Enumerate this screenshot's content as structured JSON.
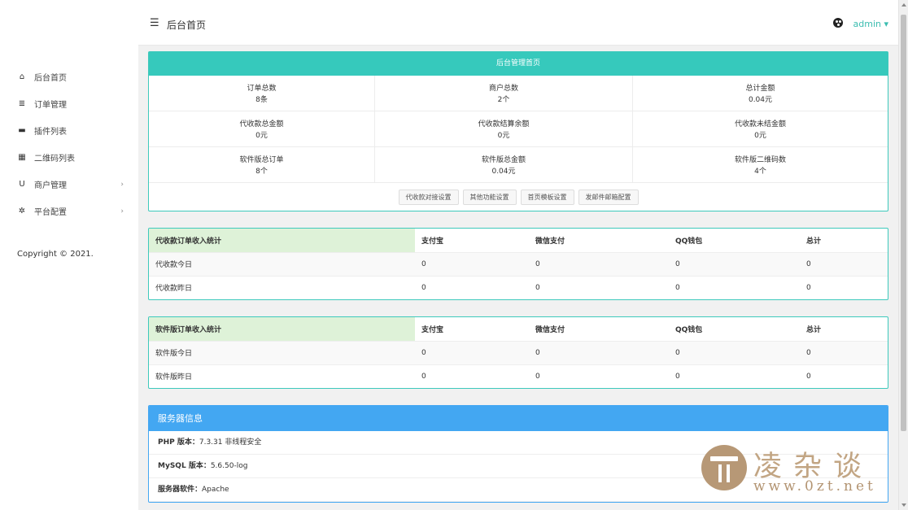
{
  "header": {
    "title": "后台首页",
    "user": "admin ▾"
  },
  "sidebar": {
    "items": [
      {
        "label": "后台首页",
        "icon": "home-icon",
        "glyph": "⌂",
        "caret": ""
      },
      {
        "label": "订单管理",
        "icon": "list-icon",
        "glyph": "≣",
        "caret": ""
      },
      {
        "label": "插件列表",
        "icon": "plugin-icon",
        "glyph": "▬",
        "caret": ""
      },
      {
        "label": "二维码列表",
        "icon": "qrcode-icon",
        "glyph": "▦",
        "caret": ""
      },
      {
        "label": "商户管理",
        "icon": "magnet-icon",
        "glyph": "U",
        "caret": "›"
      },
      {
        "label": "平台配置",
        "icon": "gear-icon",
        "glyph": "✲",
        "caret": "›"
      }
    ],
    "copyright": "Copyright © 2021."
  },
  "admin": {
    "title": "后台管理首页",
    "stats": [
      {
        "label": "订单总数",
        "value": "8条"
      },
      {
        "label": "商户总数",
        "value": "2个"
      },
      {
        "label": "总计金额",
        "value": "0.04元"
      },
      {
        "label": "代收款总金额",
        "value": "0元"
      },
      {
        "label": "代收款结算余额",
        "value": "0元"
      },
      {
        "label": "代收款未结金额",
        "value": "0元"
      },
      {
        "label": "软件版总订单",
        "value": "8个"
      },
      {
        "label": "软件版总金额",
        "value": "0.04元"
      },
      {
        "label": "软件版二维码数",
        "value": "4个"
      }
    ],
    "buttons": [
      "代收款对接设置",
      "其他功能设置",
      "首页模板设置",
      "发邮件邮箱配置"
    ]
  },
  "tables": [
    {
      "headers": [
        "代收款订单收入统计",
        "支付宝",
        "微信支付",
        "QQ钱包",
        "总计"
      ],
      "rows": [
        [
          "代收款今日",
          "0",
          "0",
          "0",
          "0"
        ],
        [
          "代收款昨日",
          "0",
          "0",
          "0",
          "0"
        ]
      ]
    },
    {
      "headers": [
        "软件版订单收入统计",
        "支付宝",
        "微信支付",
        "QQ钱包",
        "总计"
      ],
      "rows": [
        [
          "软件版今日",
          "0",
          "0",
          "0",
          "0"
        ],
        [
          "软件版昨日",
          "0",
          "0",
          "0",
          "0"
        ]
      ]
    }
  ],
  "server": {
    "title": "服务器信息",
    "rows": [
      {
        "label": "PHP 版本：",
        "value": "7.3.31 非线程安全"
      },
      {
        "label": "MySQL 版本：",
        "value": "5.6.50-log"
      },
      {
        "label": "服务器软件：",
        "value": "Apache"
      }
    ]
  },
  "watermark": {
    "chars": "凌杂谈",
    "url": "www.0zt.net"
  },
  "colors": {
    "teal": "#36c9bc",
    "blue": "#43a7f2",
    "header_green": "#def2d8"
  }
}
